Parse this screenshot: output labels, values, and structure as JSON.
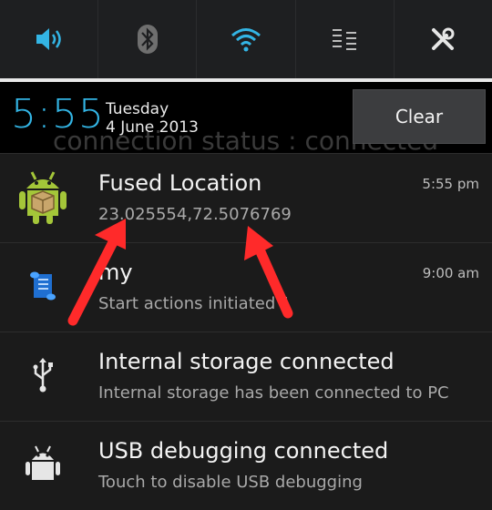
{
  "quick_toggles": [
    {
      "name": "volume",
      "icon": "speaker-icon",
      "color": "#33b5e5"
    },
    {
      "name": "bluetooth",
      "icon": "bluetooth-icon",
      "color": "#8c8c8c"
    },
    {
      "name": "wifi",
      "icon": "wifi-icon",
      "color": "#33b5e5"
    },
    {
      "name": "data",
      "icon": "settings-list-icon",
      "color": "#bdbdbd"
    },
    {
      "name": "settings",
      "icon": "tools-icon",
      "color": "#e6e6e6"
    }
  ],
  "header": {
    "time": "5:55",
    "day": "Tuesday",
    "date": "4 June 2013",
    "ghost_text": "connection status : connected",
    "clear_label": "Clear"
  },
  "notifications": [
    {
      "title": "Fused Location",
      "text": "23.025554,72.5076769",
      "time": "5:55 pm",
      "icon": "android-box-icon"
    },
    {
      "title": "my",
      "text": "Start actions initiated 1",
      "time": "9:00 am",
      "icon": "scroll-icon"
    },
    {
      "title": "Internal storage connected",
      "text": "Internal storage has been connected to PC",
      "time": "",
      "icon": "usb-icon"
    },
    {
      "title": "USB debugging connected",
      "text": "Touch to disable USB debugging",
      "time": "",
      "icon": "android-icon"
    }
  ],
  "colors": {
    "accent": "#33b5e5",
    "arrow": "#ff2a2a"
  }
}
